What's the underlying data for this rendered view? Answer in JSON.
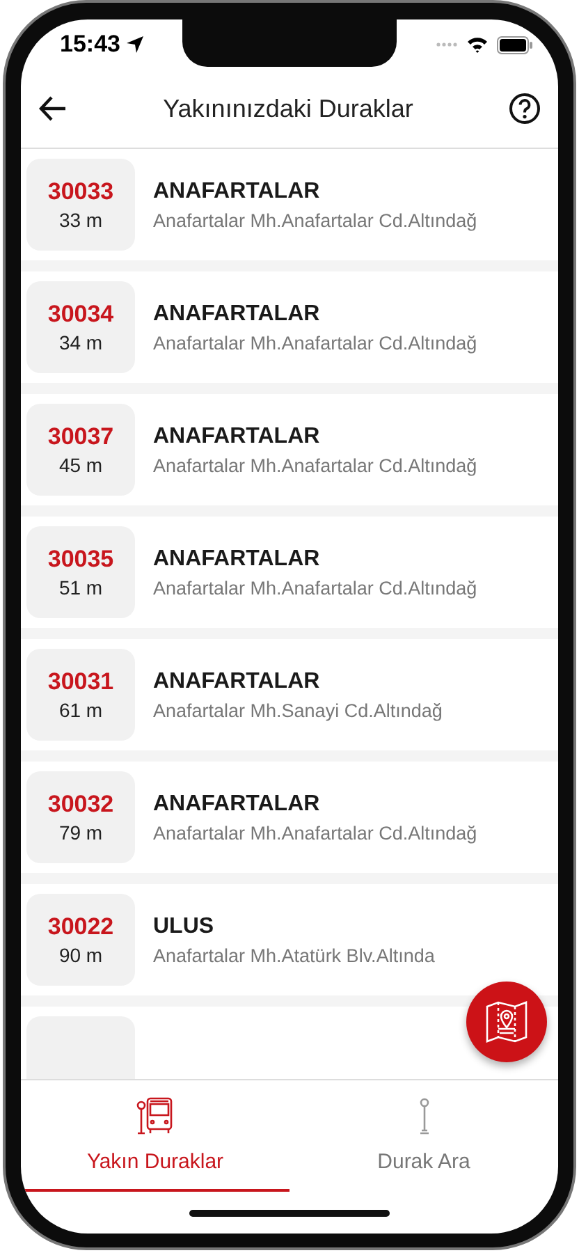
{
  "status_bar": {
    "time": "15:43"
  },
  "header": {
    "title": "Yakınınızdaki Duraklar"
  },
  "stops": [
    {
      "code": "30033",
      "distance": "33 m",
      "name": "ANAFARTALAR",
      "address": "Anafartalar Mh.Anafartalar Cd.Altındağ"
    },
    {
      "code": "30034",
      "distance": "34 m",
      "name": "ANAFARTALAR",
      "address": "Anafartalar Mh.Anafartalar Cd.Altındağ"
    },
    {
      "code": "30037",
      "distance": "45 m",
      "name": "ANAFARTALAR",
      "address": "Anafartalar Mh.Anafartalar Cd.Altındağ"
    },
    {
      "code": "30035",
      "distance": "51 m",
      "name": "ANAFARTALAR",
      "address": "Anafartalar Mh.Anafartalar Cd.Altındağ"
    },
    {
      "code": "30031",
      "distance": "61 m",
      "name": "ANAFARTALAR",
      "address": "Anafartalar Mh.Sanayi Cd.Altındağ"
    },
    {
      "code": "30032",
      "distance": "79 m",
      "name": "ANAFARTALAR",
      "address": "Anafartalar Mh.Anafartalar Cd.Altındağ"
    },
    {
      "code": "30022",
      "distance": "90 m",
      "name": "ULUS",
      "address": "Anafartalar Mh.Atatürk Blv.Altında"
    }
  ],
  "tabs": [
    {
      "label": "Yakın Duraklar",
      "selected": true,
      "kind": "bus-stop"
    },
    {
      "label": "Durak Ara",
      "selected": false,
      "kind": "stop-pole"
    }
  ]
}
